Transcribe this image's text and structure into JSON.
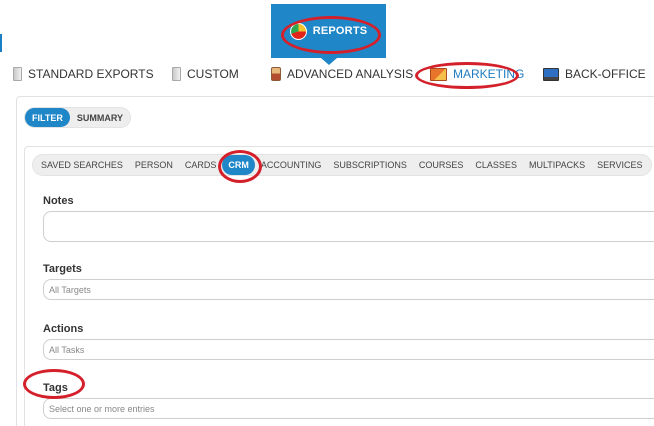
{
  "reports": {
    "label": "REPORTS",
    "icon": "pie-chart-icon"
  },
  "top_menu": [
    {
      "label": "STANDARD EXPORTS",
      "icon": "document-icon"
    },
    {
      "label": "CUSTOM",
      "icon": "document-icon"
    },
    {
      "label": "ADVANCED ANALYSIS",
      "icon": "mug-icon"
    },
    {
      "label": "MARKETING",
      "icon": "marketing-icon",
      "active": true
    },
    {
      "label": "BACK-OFFICE",
      "icon": "computer-icon"
    }
  ],
  "view_toggle": {
    "filter": "FILTER",
    "summary": "SUMMARY",
    "active": "FILTER"
  },
  "subtabs": [
    "SAVED SEARCHES",
    "PERSON",
    "CARDS",
    "CRM",
    "ACCOUNTING",
    "SUBSCRIPTIONS",
    "COURSES",
    "CLASSES",
    "MULTIPACKS",
    "SERVICES"
  ],
  "active_subtab": "CRM",
  "fields": {
    "notes": {
      "label": "Notes",
      "placeholder": ""
    },
    "targets": {
      "label": "Targets",
      "placeholder": "All Targets"
    },
    "actions": {
      "label": "Actions",
      "placeholder": "All Tasks"
    },
    "tags": {
      "label": "Tags",
      "placeholder": "Select one or more entries"
    }
  },
  "colors": {
    "accent": "#1f86c8",
    "annotation": "#d4202a"
  }
}
